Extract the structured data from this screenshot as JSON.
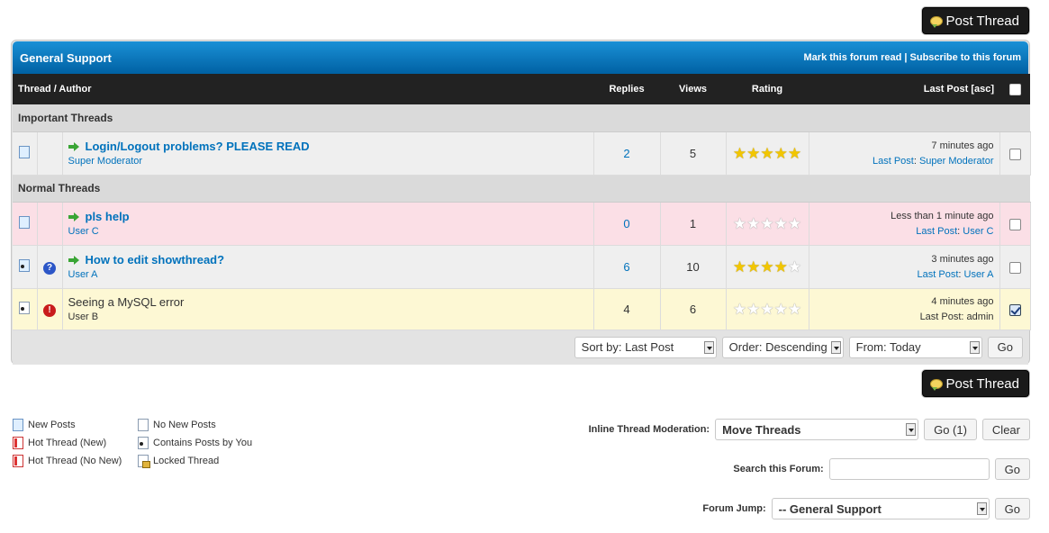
{
  "post_thread_label": "Post Thread",
  "forum": {
    "title": "General Support",
    "mark_read": "Mark this forum read",
    "separator": "|",
    "subscribe": "Subscribe to this forum"
  },
  "columns": {
    "thread_author": "Thread / Author",
    "replies": "Replies",
    "views": "Views",
    "rating": "Rating",
    "last_post": "Last Post",
    "sort_indicator": "[asc]"
  },
  "sections": {
    "important": "Important Threads",
    "normal": "Normal Threads"
  },
  "threads": [
    {
      "subject": "Login/Logout problems? PLEASE READ",
      "author": "Super Moderator",
      "replies": "2",
      "views": "5",
      "rating": 5,
      "last_time": "7 minutes ago",
      "last_label": "Last Post",
      "last_user": "Super Moderator",
      "checked": false,
      "status_icon": "new-posts-icon",
      "thread_icon": ""
    },
    {
      "subject": "pls help",
      "author": "User C",
      "replies": "0",
      "views": "1",
      "rating": 0,
      "last_time": "Less than 1 minute ago",
      "last_label": "Last Post",
      "last_user": "User C",
      "checked": false,
      "status_icon": "new-posts-icon",
      "thread_icon": ""
    },
    {
      "subject": "How to edit showthread?",
      "author": "User A",
      "replies": "6",
      "views": "10",
      "rating": 4,
      "last_time": "3 minutes ago",
      "last_label": "Last Post",
      "last_user": "User A",
      "checked": false,
      "status_icon": "contains-posts-by-you-icon",
      "thread_icon": "question-icon"
    },
    {
      "subject": "Seeing a MySQL error",
      "author": "User B",
      "replies": "4",
      "views": "6",
      "rating": 0,
      "last_time": "4 minutes ago",
      "last_label": "Last Post:",
      "last_user": "admin",
      "checked": true,
      "status_icon": "contains-posts-by-you-icon",
      "thread_icon": "exclamation-icon"
    }
  ],
  "sort": {
    "sort_by": "Sort by: Last Post",
    "order": "Order: Descending",
    "from": "From: Today",
    "go": "Go"
  },
  "legend": {
    "new_posts": "New Posts",
    "no_new_posts": "No New Posts",
    "hot_new": "Hot Thread (New)",
    "contains_you": "Contains Posts by You",
    "hot_no_new": "Hot Thread (No New)",
    "locked": "Locked Thread"
  },
  "moderation": {
    "label": "Inline Thread Moderation:",
    "action": "Move Threads",
    "go": "Go (1)",
    "clear": "Clear"
  },
  "search": {
    "label": "Search this Forum:",
    "value": "",
    "go": "Go"
  },
  "jump": {
    "label": "Forum Jump:",
    "value": "-- General Support",
    "go": "Go"
  }
}
